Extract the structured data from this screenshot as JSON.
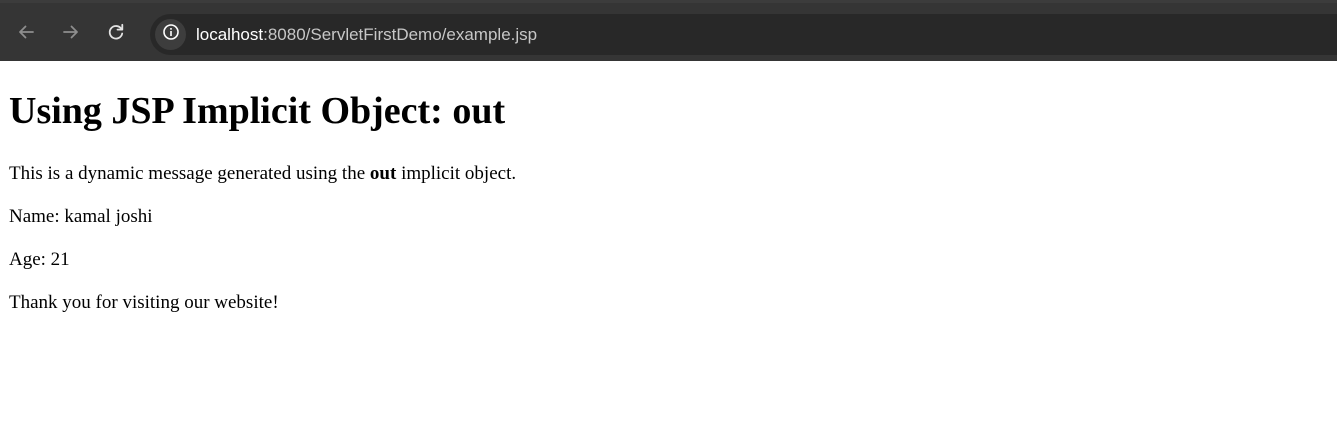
{
  "browser": {
    "url_host": "localhost",
    "url_rest": ":8080/ServletFirstDemo/example.jsp",
    "icons": {
      "back": "arrow-back-icon",
      "forward": "arrow-forward-icon",
      "reload": "reload-icon",
      "site_info": "info-icon"
    },
    "colors": {
      "toolbar": "#353535",
      "omnibox": "#282828",
      "icon": "#8e8e8e"
    }
  },
  "page": {
    "heading": "Using JSP Implicit Object: out",
    "message_before": "This is a dynamic message generated using the ",
    "message_bold": "out",
    "message_after": " implicit object.",
    "name_line": "Name: kamal joshi",
    "age_line": "Age: 21",
    "thanks_line": "Thank you for visiting our website!"
  }
}
